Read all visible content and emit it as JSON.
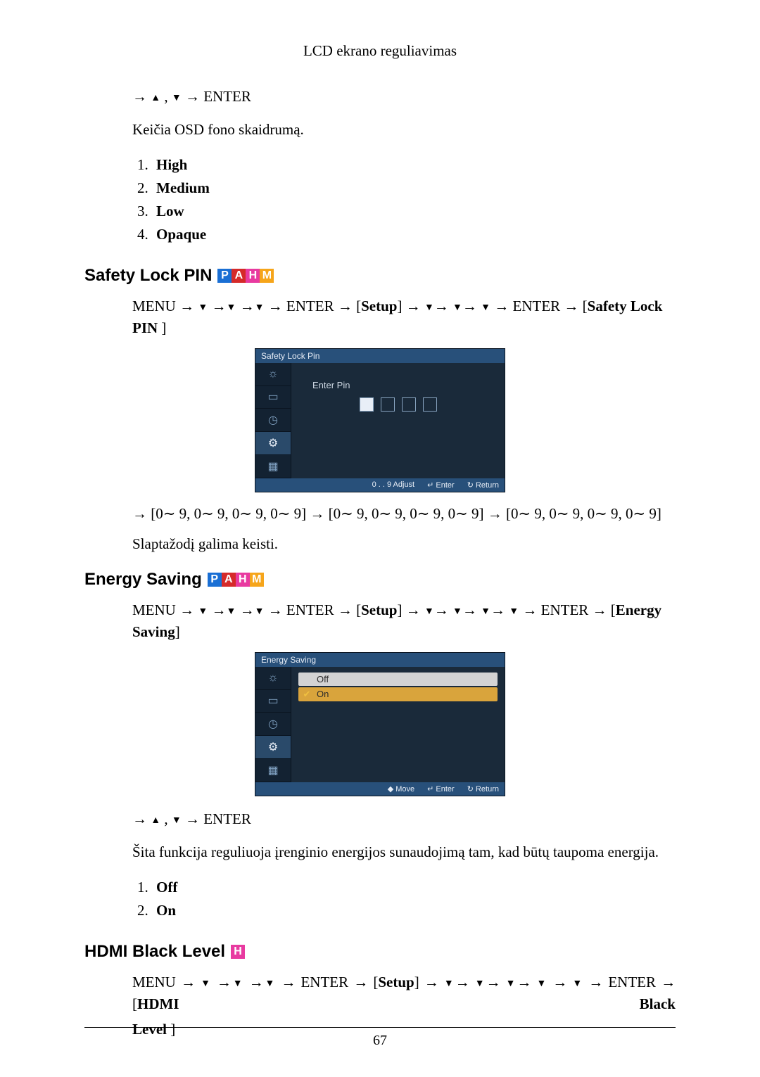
{
  "header": {
    "title": "LCD ekrano reguliavimas"
  },
  "intro": {
    "nav_prefix": "→ ",
    "nav_sep": " , ",
    "nav_arrow": " → ",
    "enter": "ENTER",
    "desc": "Keičia OSD fono skaidrumą.",
    "options": [
      "High",
      "Medium",
      "Low",
      "Opaque"
    ]
  },
  "sections": {
    "safety": {
      "heading": "Safety Lock PIN",
      "badges": [
        "P",
        "A",
        "H",
        "M"
      ],
      "path_prefix": "MENU → ",
      "enter": "ENTER",
      "setup": "Setup",
      "tail_label": "Safety Lock PIN",
      "osd": {
        "title": "Safety Lock Pin",
        "pin_label": "Enter  Pin",
        "footer": [
          "0 . . 9  Adjust",
          "↵ Enter",
          "↻ Return"
        ]
      },
      "pin_seq": "→ [0∼ 9, 0∼ 9, 0∼ 9, 0∼ 9] → [0∼ 9, 0∼ 9, 0∼ 9, 0∼ 9] → [0∼ 9, 0∼ 9, 0∼ 9, 0∼ 9]",
      "pin_desc": "Slaptažodį galima keisti."
    },
    "energy": {
      "heading": "Energy Saving",
      "badges": [
        "P",
        "A",
        "H",
        "M"
      ],
      "path_prefix": "MENU → ",
      "enter": "ENTER",
      "setup": "Setup",
      "tail_label": "Energy Saving",
      "osd": {
        "title": "Energy Saving",
        "options": [
          "Off",
          "On"
        ],
        "footer": [
          "◆ Move",
          "↵ Enter",
          "↻ Return"
        ]
      },
      "nav_after": "→ ",
      "nav_sep": " , ",
      "desc": "Šita funkcija reguliuoja įrenginio energijos sunaudojimą tam, kad būtų taupoma energija.",
      "options": [
        "Off",
        "On"
      ]
    },
    "hdmi": {
      "heading": "HDMI Black Level",
      "badges": [
        "H"
      ],
      "path_prefix": "MENU → ",
      "enter": "ENTER",
      "setup": "Setup",
      "tail_label_1": "HDMI Black",
      "tail_label_2": "Level"
    }
  },
  "footer": {
    "page": "67"
  },
  "colors": {
    "p": "#1a6fd4",
    "a": "#d52a2a",
    "h": "#e83aa0",
    "m": "#f6a51a"
  }
}
